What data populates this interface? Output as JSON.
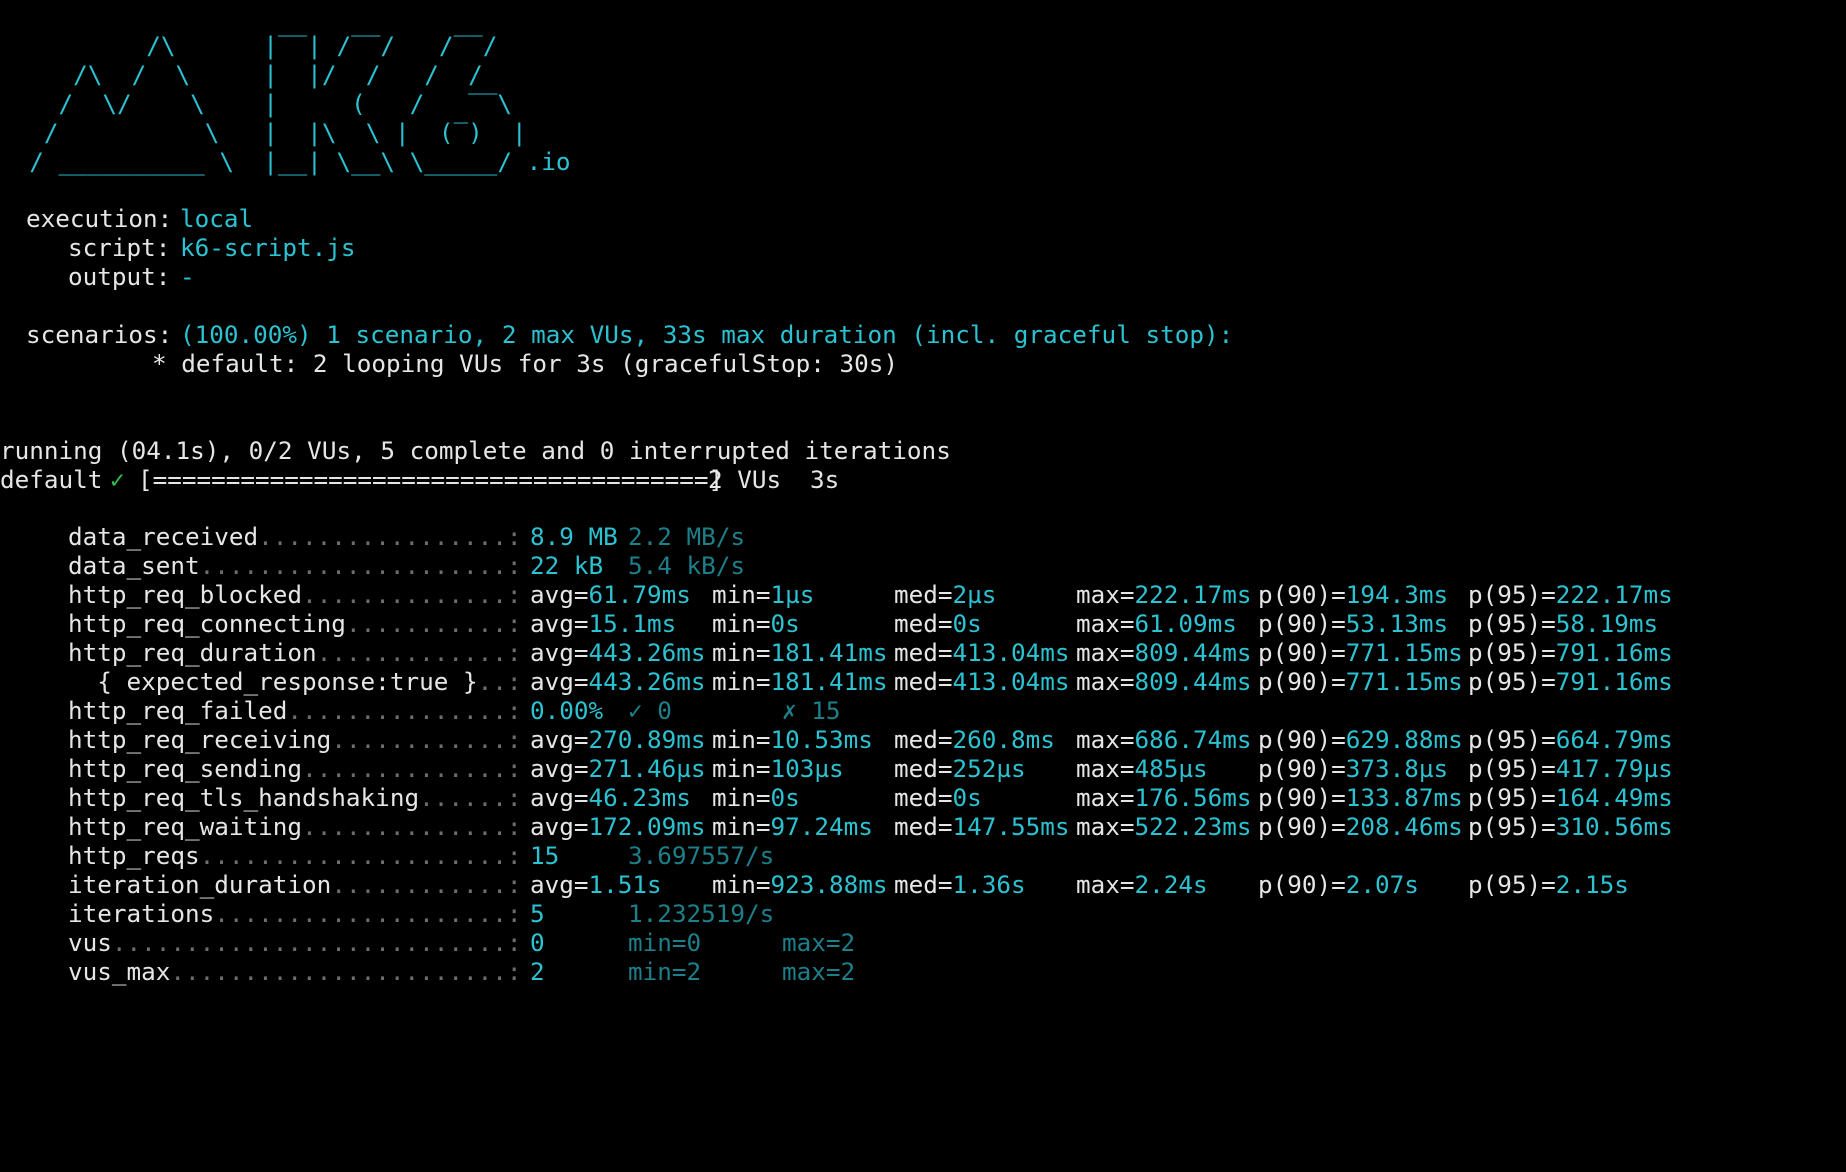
{
  "colors": {
    "background": "#000000",
    "text": "#e6e6e6",
    "accent_cyan": "#2bc2d2",
    "dim_cyan": "#1d7f89",
    "check_green": "#2fbf4f"
  },
  "logo": {
    "lines": [
      "          /\\      |‾‾| /‾‾/   /‾‾/",
      "     /\\  /  \\     |  |/  /   /  /",
      "    /  \\/    \\    |     (   /   ‾‾\\",
      "   /          \\   |  |\\  \\ |  (‾)  |",
      "  / __________ \\  |__| \\__\\ \\_____/ .io"
    ]
  },
  "config": {
    "execution_label": "execution:",
    "execution_value": "local",
    "script_label": "script:",
    "script_value": "k6-script.js",
    "output_label": "output:",
    "output_value": "-",
    "scenarios_label": "scenarios:",
    "scenarios_value": "(100.00%) 1 scenario, 2 max VUs, 33s max duration (incl. graceful stop):",
    "scenario_detail": "* default: 2 looping VUs for 3s (gracefulStop: 30s)"
  },
  "progress": {
    "running_line": "running (04.1s), 0/2 VUs, 5 complete and 0 interrupted iterations",
    "scenario_name": "default",
    "check_mark": "✓",
    "bar": "[======================================]",
    "bar_fill_fraction": 1.0,
    "vus": "2 VUs",
    "duration": "3s"
  },
  "metrics": [
    {
      "name": "data_received",
      "dots": "..................:",
      "cells": [
        {
          "k": "",
          "v": "8.9 MB",
          "style": "cyan"
        },
        {
          "k": "",
          "v": "2.2 MB/s",
          "style": "dim"
        }
      ]
    },
    {
      "name": "data_sent",
      "dots": "......................:",
      "cells": [
        {
          "k": "",
          "v": "22 kB",
          "style": "cyan"
        },
        {
          "k": "",
          "v": "5.4 kB/s",
          "style": "dim"
        }
      ]
    },
    {
      "name": "http_req_blocked",
      "dots": "...............:",
      "cells": [
        {
          "k": "avg=",
          "v": "61.79ms"
        },
        {
          "k": "min=",
          "v": "1µs"
        },
        {
          "k": "med=",
          "v": "2µs"
        },
        {
          "k": "max=",
          "v": "222.17ms"
        },
        {
          "k": "p(90)=",
          "v": "194.3ms"
        },
        {
          "k": "p(95)=",
          "v": "222.17ms"
        }
      ]
    },
    {
      "name": "http_req_connecting",
      "dots": "............:",
      "cells": [
        {
          "k": "avg=",
          "v": "15.1ms"
        },
        {
          "k": "min=",
          "v": "0s"
        },
        {
          "k": "med=",
          "v": "0s"
        },
        {
          "k": "max=",
          "v": "61.09ms"
        },
        {
          "k": "p(90)=",
          "v": "53.13ms"
        },
        {
          "k": "p(95)=",
          "v": "58.19ms"
        }
      ]
    },
    {
      "name": "http_req_duration",
      "dots": "..............:",
      "cells": [
        {
          "k": "avg=",
          "v": "443.26ms"
        },
        {
          "k": "min=",
          "v": "181.41ms"
        },
        {
          "k": "med=",
          "v": "413.04ms"
        },
        {
          "k": "max=",
          "v": "809.44ms"
        },
        {
          "k": "p(90)=",
          "v": "771.15ms"
        },
        {
          "k": "p(95)=",
          "v": "791.16ms"
        }
      ]
    },
    {
      "name": "  { expected_response:true }",
      "dots": "...:",
      "cells": [
        {
          "k": "avg=",
          "v": "443.26ms"
        },
        {
          "k": "min=",
          "v": "181.41ms"
        },
        {
          "k": "med=",
          "v": "413.04ms"
        },
        {
          "k": "max=",
          "v": "809.44ms"
        },
        {
          "k": "p(90)=",
          "v": "771.15ms"
        },
        {
          "k": "p(95)=",
          "v": "791.16ms"
        }
      ]
    },
    {
      "name": "http_req_failed",
      "dots": "................:",
      "cells": [
        {
          "k": "",
          "v": "0.00%",
          "style": "cyan"
        },
        {
          "k": "",
          "v": "✓ 0",
          "style": "dim"
        },
        {
          "k": "",
          "v": "✗ 15",
          "style": "dim"
        }
      ]
    },
    {
      "name": "http_req_receiving",
      "dots": ".............:",
      "cells": [
        {
          "k": "avg=",
          "v": "270.89ms"
        },
        {
          "k": "min=",
          "v": "10.53ms"
        },
        {
          "k": "med=",
          "v": "260.8ms"
        },
        {
          "k": "max=",
          "v": "686.74ms"
        },
        {
          "k": "p(90)=",
          "v": "629.88ms"
        },
        {
          "k": "p(95)=",
          "v": "664.79ms"
        }
      ]
    },
    {
      "name": "http_req_sending",
      "dots": "...............:",
      "cells": [
        {
          "k": "avg=",
          "v": "271.46µs"
        },
        {
          "k": "min=",
          "v": "103µs"
        },
        {
          "k": "med=",
          "v": "252µs"
        },
        {
          "k": "max=",
          "v": "485µs"
        },
        {
          "k": "p(90)=",
          "v": "373.8µs"
        },
        {
          "k": "p(95)=",
          "v": "417.79µs"
        }
      ]
    },
    {
      "name": "http_req_tls_handshaking",
      "dots": ".......:",
      "cells": [
        {
          "k": "avg=",
          "v": "46.23ms"
        },
        {
          "k": "min=",
          "v": "0s"
        },
        {
          "k": "med=",
          "v": "0s"
        },
        {
          "k": "max=",
          "v": "176.56ms"
        },
        {
          "k": "p(90)=",
          "v": "133.87ms"
        },
        {
          "k": "p(95)=",
          "v": "164.49ms"
        }
      ]
    },
    {
      "name": "http_req_waiting",
      "dots": "...............:",
      "cells": [
        {
          "k": "avg=",
          "v": "172.09ms"
        },
        {
          "k": "min=",
          "v": "97.24ms"
        },
        {
          "k": "med=",
          "v": "147.55ms"
        },
        {
          "k": "max=",
          "v": "522.23ms"
        },
        {
          "k": "p(90)=",
          "v": "208.46ms"
        },
        {
          "k": "p(95)=",
          "v": "310.56ms"
        }
      ]
    },
    {
      "name": "http_reqs",
      "dots": "......................:",
      "cells": [
        {
          "k": "",
          "v": "15",
          "style": "cyan"
        },
        {
          "k": "",
          "v": "3.697557/s",
          "style": "dim"
        }
      ]
    },
    {
      "name": "iteration_duration",
      "dots": ".............:",
      "cells": [
        {
          "k": "avg=",
          "v": "1.51s"
        },
        {
          "k": "min=",
          "v": "923.88ms"
        },
        {
          "k": "med=",
          "v": "1.36s"
        },
        {
          "k": "max=",
          "v": "2.24s"
        },
        {
          "k": "p(90)=",
          "v": "2.07s"
        },
        {
          "k": "p(95)=",
          "v": "2.15s"
        }
      ]
    },
    {
      "name": "iterations",
      "dots": ".....................:",
      "cells": [
        {
          "k": "",
          "v": "5",
          "style": "cyan"
        },
        {
          "k": "",
          "v": "1.232519/s",
          "style": "dim"
        }
      ]
    },
    {
      "name": "vus",
      "dots": "............................:",
      "cells": [
        {
          "k": "",
          "v": "0",
          "style": "cyan"
        },
        {
          "k": "",
          "v": "min=0",
          "style": "dim"
        },
        {
          "k": "",
          "v": "max=2",
          "style": "dim"
        }
      ]
    },
    {
      "name": "vus_max",
      "dots": "........................:",
      "cells": [
        {
          "k": "",
          "v": "2",
          "style": "cyan"
        },
        {
          "k": "",
          "v": "min=2",
          "style": "dim"
        },
        {
          "k": "",
          "v": "max=2",
          "style": "dim"
        }
      ]
    }
  ]
}
